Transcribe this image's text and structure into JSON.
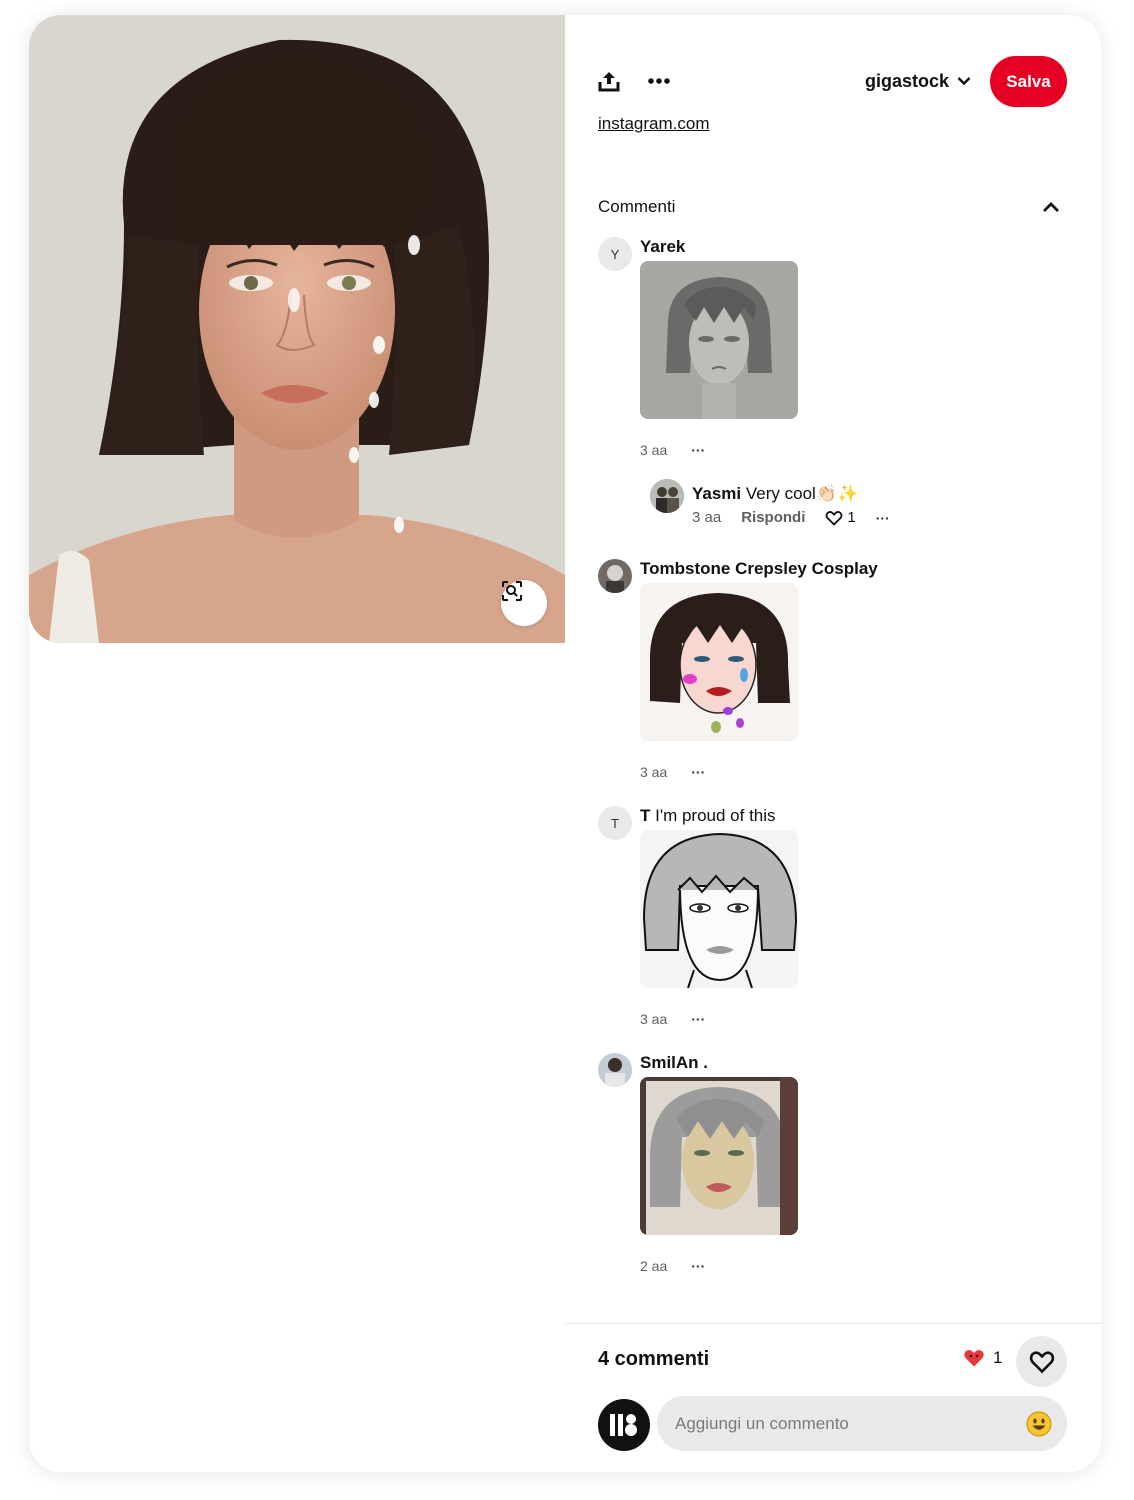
{
  "pin": {
    "source_link": "instagram.com"
  },
  "header": {
    "board_name": "gigastock",
    "save_label": "Salva"
  },
  "comments_section": {
    "title": "Commenti",
    "items": [
      {
        "avatar_initial": "Y",
        "author": "Yarek",
        "text": "",
        "time": "3 aa",
        "more": "···",
        "image": "pencil-portrait-sketch",
        "reply": {
          "author": "Yasmi",
          "text": "Very cool👏🏻✨",
          "time": "3 aa",
          "reply_label": "Rispondi",
          "likes": "1",
          "more": "···"
        }
      },
      {
        "avatar_initial": "",
        "author": "Tombstone Crepsley Cosplay",
        "text": "",
        "time": "3 aa",
        "more": "···",
        "image": "colored-portrait-drawing"
      },
      {
        "avatar_initial": "T",
        "author": "T",
        "text": "I'm proud of this",
        "time": "3 aa",
        "more": "···",
        "image": "digital-grayscale-portrait"
      },
      {
        "avatar_initial": "",
        "author": "SmilAn .",
        "text": "",
        "time": "2 aa",
        "more": "···",
        "image": "watercolor-portrait"
      }
    ]
  },
  "footer": {
    "count_label": "4 commenti",
    "reaction_count": "1",
    "input_placeholder": "Aggiungi un commento"
  },
  "colors": {
    "brand_red": "#e60023",
    "gray_button": "#e9e9e9"
  },
  "icons": [
    "share-icon",
    "more-icon",
    "chevron-down-icon",
    "chevron-up-icon",
    "visual-search-icon",
    "heart-icon",
    "heart-reaction-icon",
    "emoji-icon"
  ]
}
